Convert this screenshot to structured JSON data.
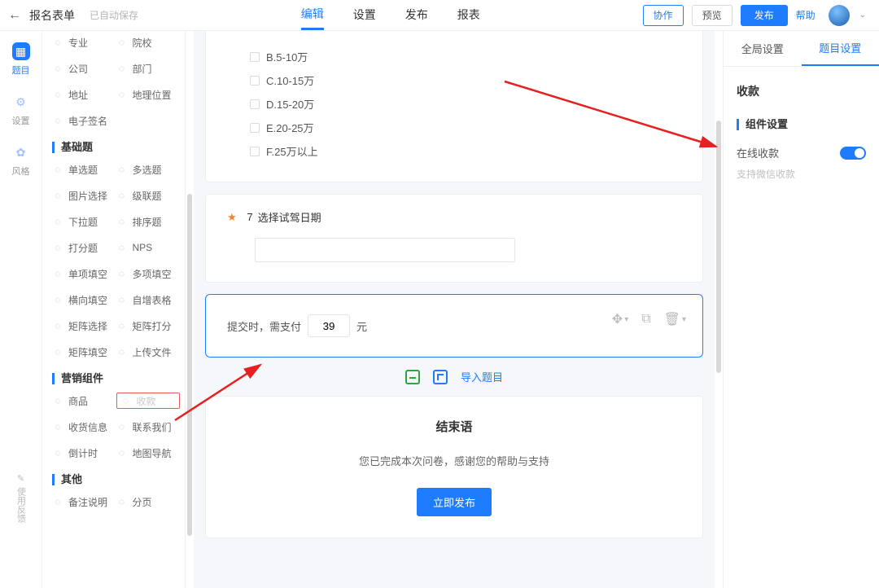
{
  "header": {
    "form_name": "报名表单",
    "saved": "已自动保存",
    "tabs": {
      "edit": "编辑",
      "settings": "设置",
      "publish": "发布",
      "report": "报表"
    },
    "collab": "协作",
    "preview": "预览",
    "publish_btn": "发布",
    "help": "帮助"
  },
  "rail": {
    "items": "题目",
    "settings": "设置",
    "style": "风格",
    "feedback": "使用反馈"
  },
  "palette": {
    "group_top": [
      {
        "label": "专业"
      },
      {
        "label": "院校"
      },
      {
        "label": "公司"
      },
      {
        "label": "部门"
      },
      {
        "label": "地址"
      },
      {
        "label": "地理位置"
      },
      {
        "label": "电子签名"
      }
    ],
    "group_basic_head": "基础题",
    "group_basic": [
      {
        "label": "单选题"
      },
      {
        "label": "多选题"
      },
      {
        "label": "图片选择"
      },
      {
        "label": "级联题"
      },
      {
        "label": "下拉题"
      },
      {
        "label": "排序题"
      },
      {
        "label": "打分题"
      },
      {
        "label": "NPS"
      },
      {
        "label": "单项填空"
      },
      {
        "label": "多项填空"
      },
      {
        "label": "横向填空"
      },
      {
        "label": "自增表格"
      },
      {
        "label": "矩阵选择"
      },
      {
        "label": "矩阵打分"
      },
      {
        "label": "矩阵填空"
      },
      {
        "label": "上传文件"
      }
    ],
    "group_mkt_head": "营销组件",
    "group_mkt": [
      {
        "label": "商品"
      },
      {
        "label": "收款",
        "boxed": true
      },
      {
        "label": "收货信息"
      },
      {
        "label": "联系我们"
      },
      {
        "label": "倒计时"
      },
      {
        "label": "地图导航"
      }
    ],
    "group_other_head": "其他",
    "group_other": [
      {
        "label": "备注说明"
      },
      {
        "label": "分页"
      }
    ]
  },
  "form": {
    "options": [
      {
        "label": "B.5-10万"
      },
      {
        "label": "C.10-15万"
      },
      {
        "label": "D.15-20万"
      },
      {
        "label": "E.20-25万"
      },
      {
        "label": "F.25万以上"
      }
    ],
    "q7_num": "7",
    "q7_title": "选择试驾日期",
    "pay_prefix": "提交时，需支付",
    "pay_amount": "39",
    "pay_suffix": "元",
    "import_link": "导入题目",
    "end_title": "结束语",
    "end_text": "您已完成本次问卷，感谢您的帮助与支持",
    "publish_now": "立即发布"
  },
  "right": {
    "tab_global": "全局设置",
    "tab_item": "题目设置",
    "title": "收款",
    "section": "组件设置",
    "row_label": "在线收款",
    "sub": "支持微信收款"
  }
}
